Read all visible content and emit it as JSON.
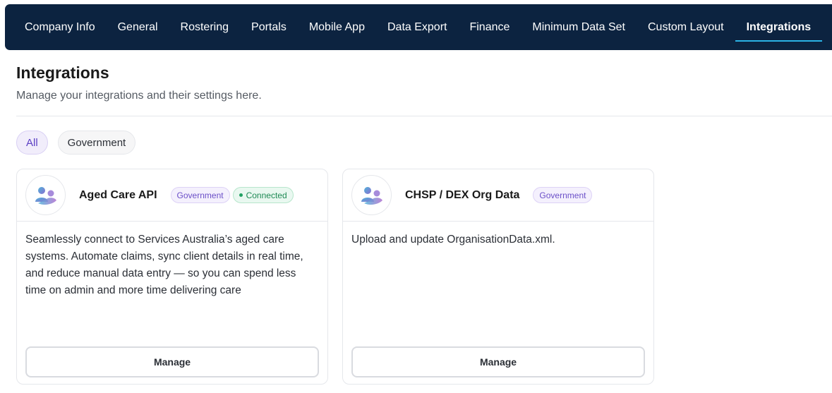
{
  "nav": {
    "items": [
      {
        "label": "Company Info",
        "active": false
      },
      {
        "label": "General",
        "active": false
      },
      {
        "label": "Rostering",
        "active": false
      },
      {
        "label": "Portals",
        "active": false
      },
      {
        "label": "Mobile App",
        "active": false
      },
      {
        "label": "Data Export",
        "active": false
      },
      {
        "label": "Finance",
        "active": false
      },
      {
        "label": "Minimum Data Set",
        "active": false
      },
      {
        "label": "Custom Layout",
        "active": false
      },
      {
        "label": "Integrations",
        "active": true
      }
    ]
  },
  "header": {
    "title": "Integrations",
    "subtitle": "Manage your integrations and their settings here."
  },
  "filters": {
    "items": [
      {
        "label": "All",
        "selected": true
      },
      {
        "label": "Government",
        "selected": false
      }
    ]
  },
  "cards": [
    {
      "icon": "people-icon",
      "title": "Aged Care API",
      "badge_category": "Government",
      "badge_status": "Connected",
      "description": "Seamlessly connect to Services Australia’s aged care systems. Automate claims, sync client details in real time, and reduce manual data entry — so you can spend less time on admin and more time delivering care",
      "button_label": "Manage"
    },
    {
      "icon": "people-icon",
      "title": "CHSP / DEX Org Data",
      "badge_category": "Government",
      "description": "Upload and update OrganisationData.xml.",
      "button_label": "Manage"
    }
  ],
  "colors": {
    "nav_bg": "#0c2340",
    "active_underline": "#2bb3e6",
    "accent_purple": "#5b3fc4",
    "status_green": "#1f8a55"
  }
}
